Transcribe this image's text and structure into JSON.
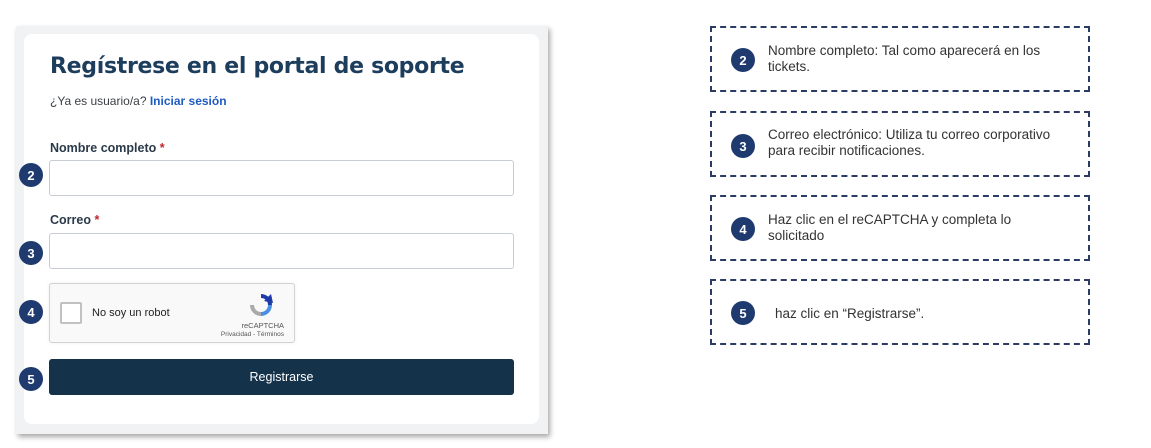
{
  "form": {
    "title": "Regístrese en el portal de soporte",
    "login_prompt": "¿Ya es usuario/a?",
    "login_link": "Iniciar sesión",
    "name_label": "Nombre completo",
    "name_value": "",
    "email_label": "Correo",
    "email_value": "",
    "required_mark": "*",
    "submit_label": "Registrarse"
  },
  "recaptcha": {
    "label": "No soy un robot",
    "brand": "reCAPTCHA",
    "links": "Privacidad - Términos"
  },
  "steps": [
    "2",
    "3",
    "4",
    "5"
  ],
  "notes": [
    {
      "number": "2",
      "text": "Nombre completo: Tal como aparecerá en los tickets."
    },
    {
      "number": "3",
      "text": "Correo electrónico: Utiliza tu correo corporativo para recibir notificaciones."
    },
    {
      "number": "4",
      "text": "Haz clic en el reCAPTCHA y completa lo solicitado"
    },
    {
      "number": "5",
      "text": "haz clic en “Registrarse”."
    }
  ],
  "colors": {
    "badge": "#1f3a6e",
    "title": "#1d3d5c",
    "link": "#1f5bbf",
    "button": "#14324a",
    "required": "#c2262c",
    "note_border": "#2a3c66"
  }
}
